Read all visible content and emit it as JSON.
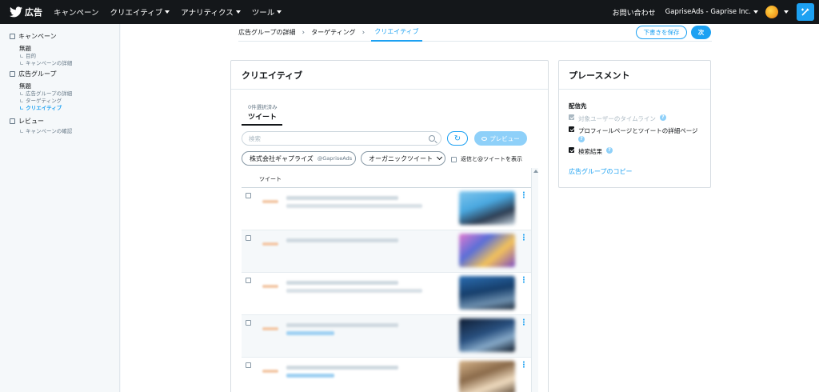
{
  "topnav": {
    "brand": "広告",
    "items": [
      "キャンペーン",
      "クリエイティブ",
      "アナリティクス",
      "ツール"
    ],
    "contact": "お問い合わせ",
    "account": "GapriseAds - Gaprise Inc."
  },
  "sidebar": {
    "campaign_head": "キャンペーン",
    "campaign_name": "無題",
    "campaign_sub": [
      "目的",
      "キャンペーンの詳細"
    ],
    "adgroup_head": "広告グループ",
    "adgroup_name": "無題",
    "adgroup_sub": [
      "広告グループの詳細",
      "ターゲティング",
      "クリエイティブ"
    ],
    "review_head": "レビュー",
    "review_sub": [
      "キャンペーンの確認"
    ]
  },
  "breadcrumb": [
    "広告グループの詳細",
    "ターゲティング",
    "クリエイティブ"
  ],
  "actions": {
    "draft": "下書きを保存",
    "next": "次"
  },
  "creative": {
    "title": "クリエイティブ",
    "selected_count": "0件選択済み",
    "tab": "ツイート",
    "search_placeholder": "検索",
    "refresh_glyph": "↻",
    "preview": "プレビュー",
    "account_name": "株式会社ギャプライズ",
    "account_handle": "@GapriseAds",
    "filter": "オーガニックツイート",
    "replies_label": "返信と@ツイートを表示",
    "column": "ツイート"
  },
  "placement": {
    "title": "プレースメント",
    "label": "配信先",
    "options": [
      "対象ユーザーのタイムライン",
      "プロフィールページとツイートの詳細ページ",
      "検索結果"
    ],
    "help_glyph": "?",
    "copy_link": "広告グループのコピー"
  },
  "colors": {
    "accent": "#1da1f2",
    "nav": "#14171a"
  }
}
